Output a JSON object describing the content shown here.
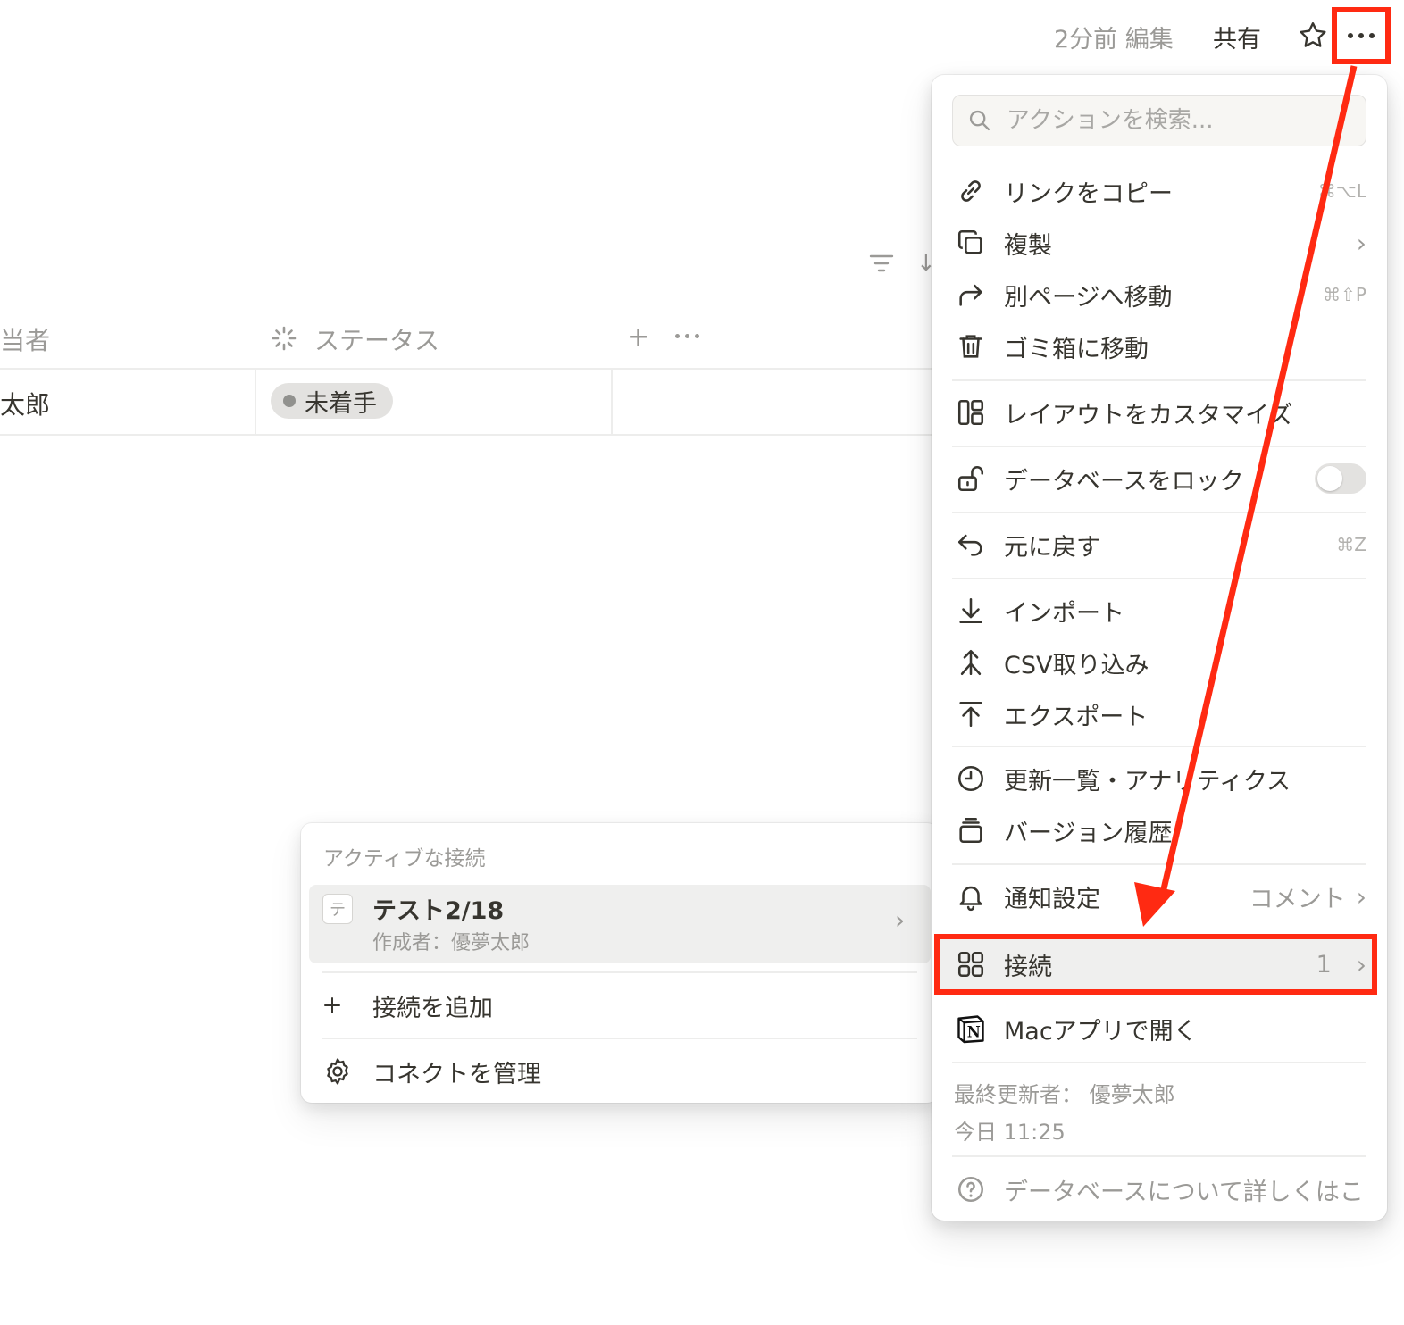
{
  "topbar": {
    "edited": "2分前 編集",
    "share": "共有"
  },
  "table": {
    "col_owner": "当者",
    "col_status": "ステータス",
    "row_owner": "太郎",
    "row_status": "未着手"
  },
  "menu": {
    "search_placeholder": "アクションを検索...",
    "items": {
      "copy_link": {
        "label": "リンクをコピー",
        "shortcut": "⌘⌥L"
      },
      "duplicate": {
        "label": "複製"
      },
      "move": {
        "label": "別ページへ移動",
        "shortcut": "⌘⇧P"
      },
      "trash": {
        "label": "ゴミ箱に移動"
      },
      "layout": {
        "label": "レイアウトをカスタマイズ"
      },
      "lock": {
        "label": "データベースをロック",
        "on": false
      },
      "undo": {
        "label": "元に戻す",
        "shortcut": "⌘Z"
      },
      "import": {
        "label": "インポート"
      },
      "csv": {
        "label": "CSV取り込み"
      },
      "export": {
        "label": "エクスポート"
      },
      "analytics": {
        "label": "更新一覧・アナリティクス"
      },
      "version": {
        "label": "バージョン履歴"
      },
      "notify": {
        "label": "通知設定",
        "value": "コメント"
      },
      "connections": {
        "label": "接続",
        "count": "1"
      },
      "mac_app": {
        "label": "Macアプリで開く"
      },
      "help": {
        "label": "データベースについて詳しくはこ"
      }
    },
    "meta": {
      "last_edited_by": "最終更新者： 優夢太郎",
      "time": "今日 11:25"
    }
  },
  "submenu": {
    "header": "アクティブな接続",
    "connection": {
      "badge": "テ",
      "title": "テスト2/18",
      "author": "作成者：優夢太郎"
    },
    "add": "接続を追加",
    "manage": "コネクトを管理"
  },
  "colors": {
    "highlight": "#ff2a12",
    "text": "#37352f",
    "muted": "#9b9a97"
  },
  "icons": [
    "search-icon",
    "link-icon",
    "duplicate-icon",
    "move-arrow-icon",
    "trash-icon",
    "layout-icon",
    "lock-icon",
    "undo-icon",
    "import-icon",
    "csv-icon",
    "export-icon",
    "clock-icon",
    "version-icon",
    "bell-icon",
    "grid-icon",
    "notion-icon",
    "help-icon",
    "plus-icon",
    "gear-icon",
    "star-icon",
    "more-icon",
    "filter-icon",
    "status-icon"
  ]
}
